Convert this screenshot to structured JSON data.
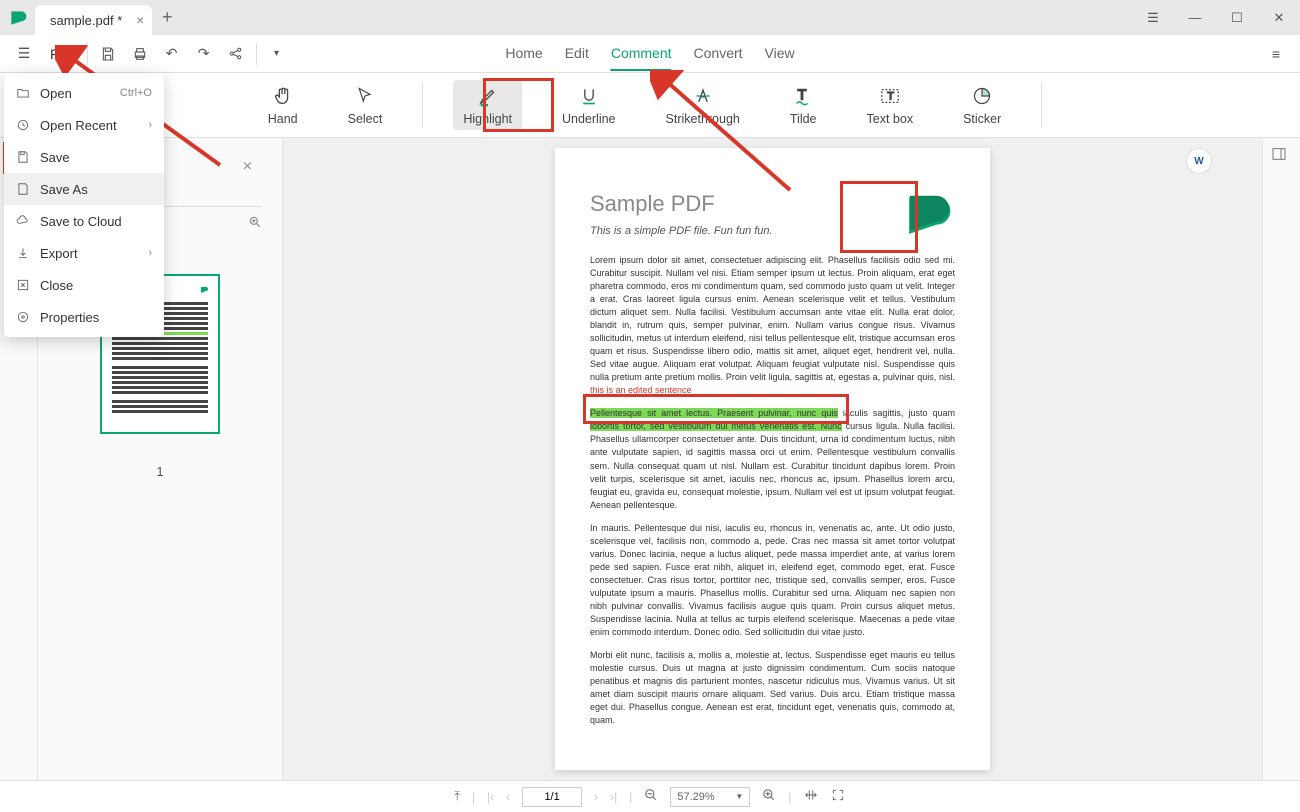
{
  "tab": {
    "title": "sample.pdf *"
  },
  "toolbar": {
    "file": "File"
  },
  "menu_tabs": {
    "home": "Home",
    "edit": "Edit",
    "comment": "Comment",
    "convert": "Convert",
    "view": "View"
  },
  "ribbon": {
    "hand": "Hand",
    "select": "Select",
    "highlight": "Highlight",
    "underline": "Underline",
    "strikethrough": "Strikethrough",
    "tilde": "Tilde",
    "textbox": "Text box",
    "sticker": "Sticker"
  },
  "file_menu": {
    "open": "Open",
    "open_shortcut": "Ctrl+O",
    "open_recent": "Open Recent",
    "save": "Save",
    "save_as": "Save As",
    "save_cloud": "Save to Cloud",
    "export": "Export",
    "close": "Close",
    "properties": "Properties"
  },
  "thumbs": {
    "title": "",
    "page_num": "1"
  },
  "doc": {
    "title": "Sample PDF",
    "subtitle": "This is a simple PDF file. Fun fun fun.",
    "para1": "Lorem ipsum dolor sit amet, consectetuer adipiscing elit. Phasellus facilisis odio sed mi. Curabitur suscipit. Nullam vel nisi. Etiam semper ipsum ut lectus. Proin aliquam, erat eget pharetra commodo, eros mi condimentum quam, sed commodo justo quam ut velit. Integer a erat. Cras laoreet ligula cursus enim. Aenean scelerisque velit et tellus. Vestibulum dictum aliquet sem. Nulla facilisi. Vestibulum accumsan ante vitae elit. Nulla erat dolor, blandit in, rutrum quis, semper pulvinar, enim. Nullam varius congue risus. Vivamus sollicitudin, metus ut interdum eleifend, nisi tellus pellentesque elit, tristique accumsan eros quam et risus. Suspendisse libero odio, mattis sit amet, aliquet eget, hendrerit vel, nulla. Sed vitae augue. Aliquam erat volutpat. Aliquam feugiat vulputate nisl. Suspendisse quis nulla pretium ante pretium mollis. Proin velit ligula, sagittis at, egestas a, pulvinar quis, nisl. ",
    "edited": "this is an edited sentence",
    "hl1": "Pellentesque sit amet lectus. Praesent pulvinar, nunc quis",
    "para2a": " iaculis sagittis, justo quam ",
    "hl2": "lobortis tortor, sed vestibulum dui metus venenatis est. Nunc",
    "para2b": " cursus ligula. Nulla facilisi. Phasellus ullamcorper consectetuer ante. Duis tincidunt, urna id condimentum luctus, nibh ante vulputate sapien, id sagittis massa orci ut enim. Pellentesque vestibulum convallis sem. Nulla consequat quam ut nisl. Nullam est. Curabitur tincidunt dapibus lorem. Proin velit turpis, scelerisque sit amet, iaculis nec, rhoncus ac, ipsum. Phasellus lorem arcu, feugiat eu, gravida eu, consequat molestie, ipsum. Nullam vel est ut ipsum volutpat feugiat. Aenean pellentesque.",
    "para3": "In mauris. Pellentesque dui nisi, iaculis eu, rhoncus in, venenatis ac, ante. Ut odio justo, scelerisque vel, facilisis non, commodo a, pede. Cras nec massa sit amet tortor volutpat varius. Donec lacinia, neque a luctus aliquet, pede massa imperdiet ante, at varius lorem pede sed sapien. Fusce erat nibh, aliquet in, eleifend eget, commodo eget, erat. Fusce consectetuer. Cras risus tortor, porttitor nec, tristique sed, convallis semper, eros. Fusce vulputate ipsum a mauris. Phasellus mollis. Curabitur sed urna. Aliquam nec sapien non nibh pulvinar convallis. Vivamus facilisis augue quis quam. Proin cursus aliquet metus. Suspendisse lacinia. Nulla at tellus ac turpis eleifend scelerisque. Maecenas a pede vitae enim commodo interdum. Donec odio. Sed sollicitudin dui vitae justo.",
    "para4": "Morbi elit nunc, facilisis a, mollis a, molestie at, lectus. Suspendisse eget mauris eu tellus molestie cursus. Duis ut magna at justo dignissim condimentum. Cum sociis natoque penatibus et magnis dis parturient montes, nascetur ridiculus mus. Vivamus varius. Ut sit amet diam suscipit mauris ornare aliquam. Sed varius. Duis arcu. Etiam tristique massa eget dui. Phasellus congue. Aenean est erat, tincidunt eget, venenatis quis, commodo at, quam."
  },
  "status": {
    "page": "1/1",
    "zoom": "57.29%"
  }
}
